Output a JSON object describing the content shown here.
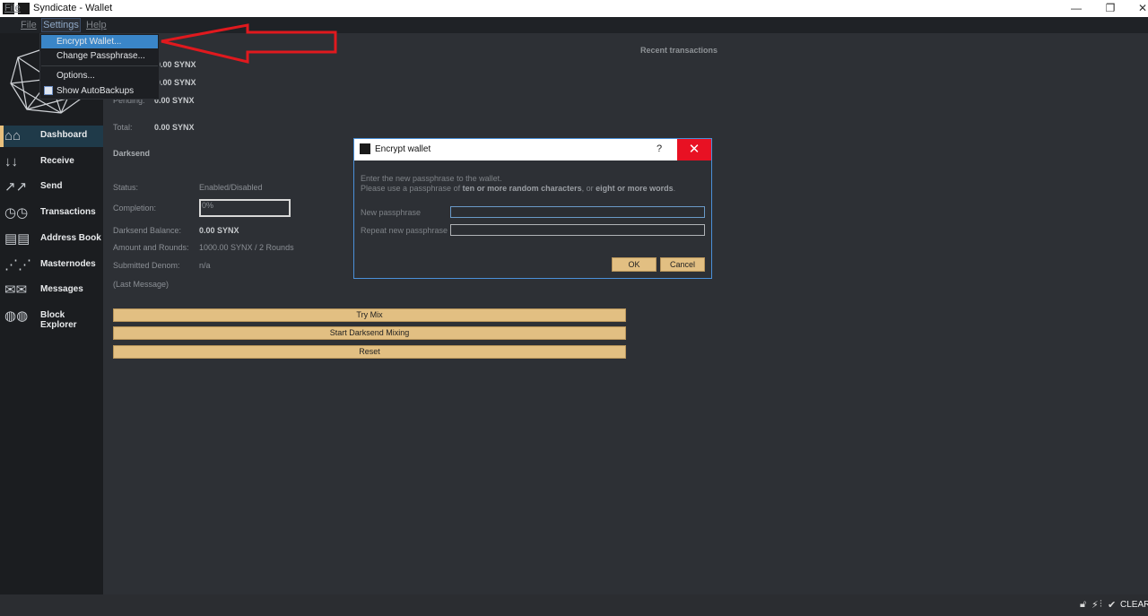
{
  "window": {
    "title": "Syndicate - Wallet",
    "minimize": "—",
    "restore": "❐",
    "close": "✕"
  },
  "menubar": {
    "items": [
      "File",
      "File",
      "Settings",
      "Help"
    ]
  },
  "settings_menu": {
    "items": [
      "Encrypt Wallet...",
      "Change Passphrase...",
      "Options...",
      "Show AutoBackups"
    ]
  },
  "sidebar": {
    "items": [
      {
        "label": "Dashboard",
        "icon": "home-icon"
      },
      {
        "label": "Receive",
        "icon": "receive-icon"
      },
      {
        "label": "Send",
        "icon": "send-icon"
      },
      {
        "label": "Transactions",
        "icon": "clock-icon"
      },
      {
        "label": "Address Book",
        "icon": "book-icon"
      },
      {
        "label": "Masternodes",
        "icon": "network-icon"
      },
      {
        "label": "Messages",
        "icon": "envelope-icon"
      },
      {
        "label": "Block Explorer",
        "icon": "globe-search-icon"
      }
    ]
  },
  "balances": {
    "available": "0.00 SYNX",
    "immature": "0.00 SYNX",
    "pending_label": "Pending:",
    "pending": "0.00 SYNX",
    "total_label": "Total:",
    "total": "0.00 SYNX"
  },
  "recent_transactions_title": "Recent transactions",
  "darksend": {
    "title": "Darksend",
    "status_label": "Status:",
    "status": "Enabled/Disabled",
    "completion_label": "Completion:",
    "completion": "0%",
    "balance_label": "Darksend Balance:",
    "balance": "0.00 SYNX",
    "rounds_label": "Amount and Rounds:",
    "rounds": "1000.00 SYNX / 2 Rounds",
    "denom_label": "Submitted Denom:",
    "denom": "n/a",
    "last_message": "(Last Message)",
    "buttons": [
      "Try Mix",
      "Start Darksend Mixing",
      "Reset"
    ]
  },
  "dialog": {
    "title": "Encrypt wallet",
    "help": "?",
    "close": "✕",
    "line1": "Enter the new passphrase to the wallet.",
    "line2_a": "Please use a passphrase of ",
    "line2_b": "ten or more random characters",
    "line2_c": ", or ",
    "line2_d": "eight or more words",
    "line2_e": ".",
    "new_label": "New passphrase",
    "repeat_label": "Repeat new passphrase",
    "ok": "OK",
    "cancel": "Cancel"
  },
  "statusbar": {
    "text": "CLEARN"
  },
  "colors": {
    "accent": "#e2bf82",
    "menu_highlight": "#3a86c8",
    "close_red": "#e81123",
    "arrow_red": "#e0191e"
  }
}
